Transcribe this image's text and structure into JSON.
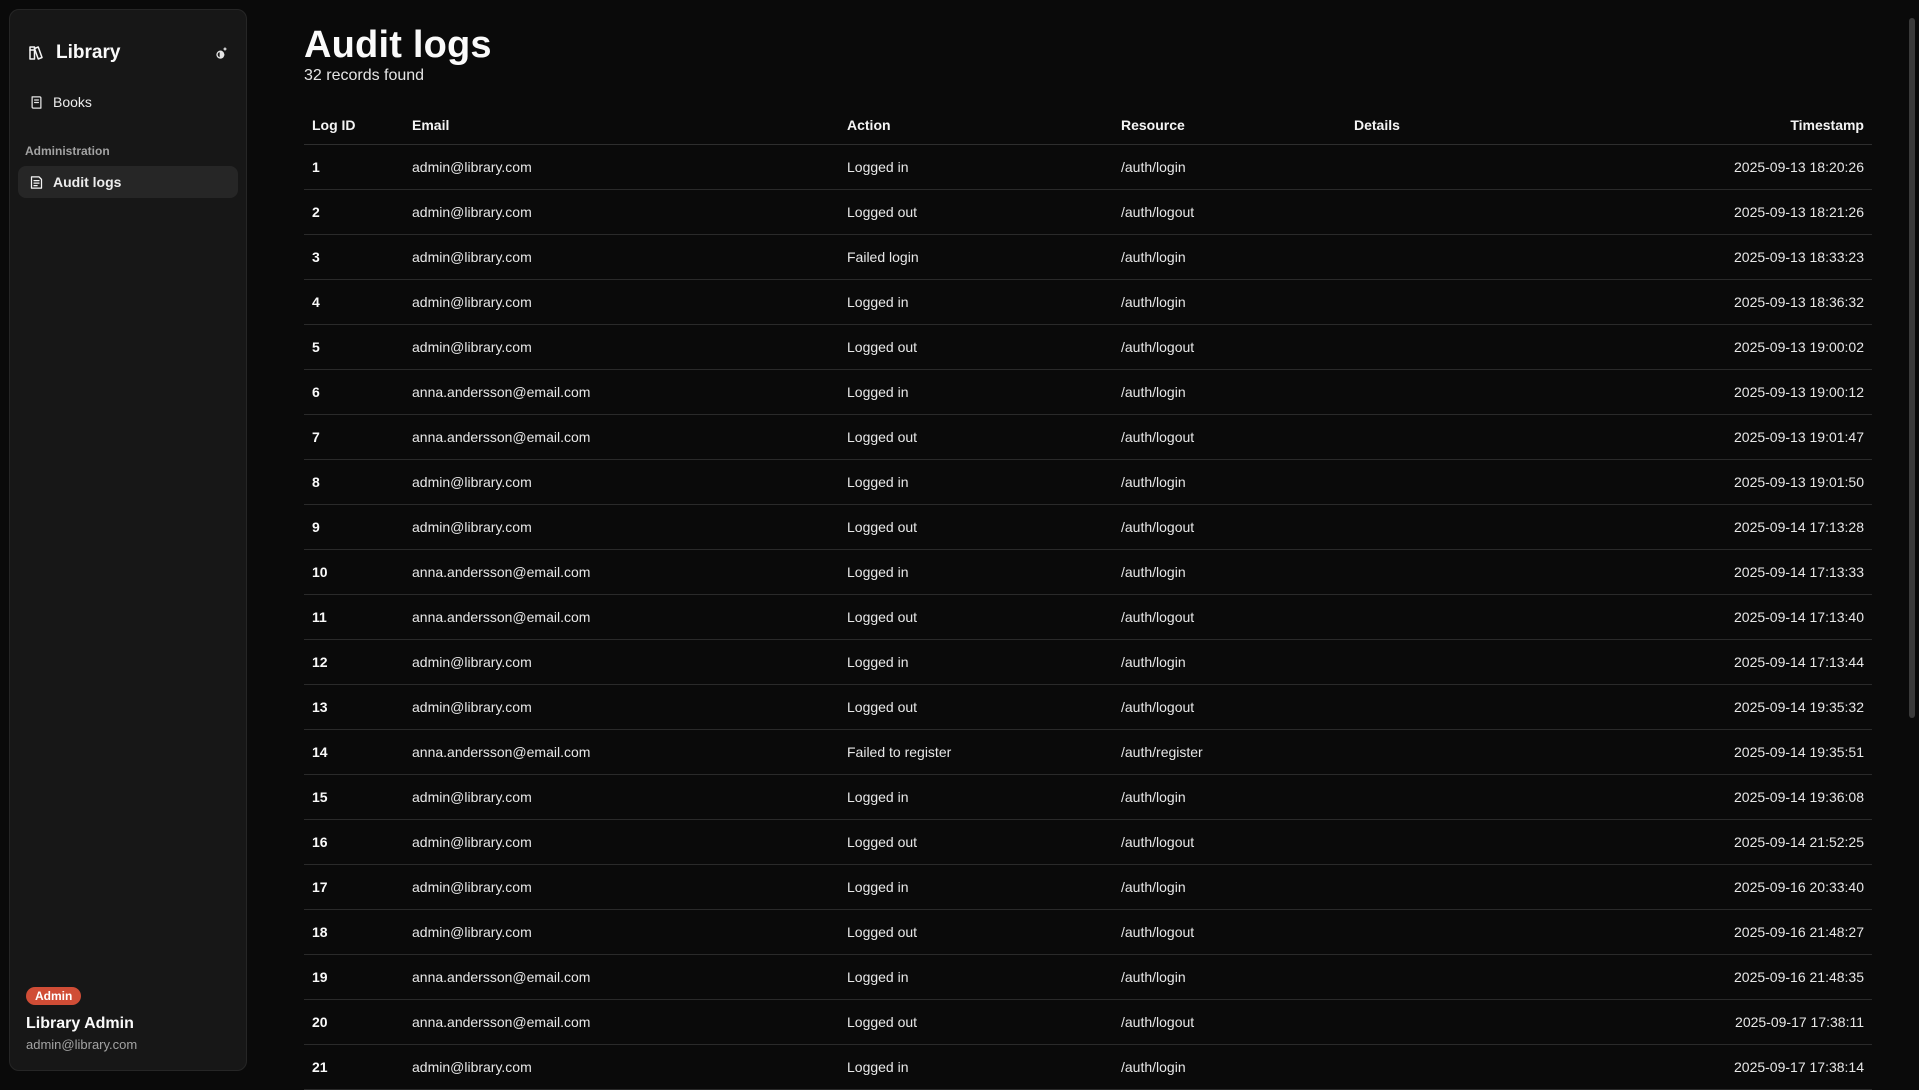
{
  "sidebar": {
    "brand": "Library",
    "nav_books": "Books",
    "section_admin": "Administration",
    "nav_audit": "Audit logs",
    "user": {
      "role": "Admin",
      "name": "Library Admin",
      "email": "admin@library.com"
    }
  },
  "page": {
    "title": "Audit logs",
    "subtitle": "32 records found"
  },
  "table": {
    "headers": {
      "id": "Log ID",
      "email": "Email",
      "action": "Action",
      "resource": "Resource",
      "details": "Details",
      "timestamp": "Timestamp"
    },
    "rows": [
      {
        "id": "1",
        "email": "admin@library.com",
        "action": "Logged in",
        "resource": "/auth/login",
        "details": "",
        "ts": "2025-09-13 18:20:26"
      },
      {
        "id": "2",
        "email": "admin@library.com",
        "action": "Logged out",
        "resource": "/auth/logout",
        "details": "",
        "ts": "2025-09-13 18:21:26"
      },
      {
        "id": "3",
        "email": "admin@library.com",
        "action": "Failed login",
        "resource": "/auth/login",
        "details": "",
        "ts": "2025-09-13 18:33:23"
      },
      {
        "id": "4",
        "email": "admin@library.com",
        "action": "Logged in",
        "resource": "/auth/login",
        "details": "",
        "ts": "2025-09-13 18:36:32"
      },
      {
        "id": "5",
        "email": "admin@library.com",
        "action": "Logged out",
        "resource": "/auth/logout",
        "details": "",
        "ts": "2025-09-13 19:00:02"
      },
      {
        "id": "6",
        "email": "anna.andersson@email.com",
        "action": "Logged in",
        "resource": "/auth/login",
        "details": "",
        "ts": "2025-09-13 19:00:12"
      },
      {
        "id": "7",
        "email": "anna.andersson@email.com",
        "action": "Logged out",
        "resource": "/auth/logout",
        "details": "",
        "ts": "2025-09-13 19:01:47"
      },
      {
        "id": "8",
        "email": "admin@library.com",
        "action": "Logged in",
        "resource": "/auth/login",
        "details": "",
        "ts": "2025-09-13 19:01:50"
      },
      {
        "id": "9",
        "email": "admin@library.com",
        "action": "Logged out",
        "resource": "/auth/logout",
        "details": "",
        "ts": "2025-09-14 17:13:28"
      },
      {
        "id": "10",
        "email": "anna.andersson@email.com",
        "action": "Logged in",
        "resource": "/auth/login",
        "details": "",
        "ts": "2025-09-14 17:13:33"
      },
      {
        "id": "11",
        "email": "anna.andersson@email.com",
        "action": "Logged out",
        "resource": "/auth/logout",
        "details": "",
        "ts": "2025-09-14 17:13:40"
      },
      {
        "id": "12",
        "email": "admin@library.com",
        "action": "Logged in",
        "resource": "/auth/login",
        "details": "",
        "ts": "2025-09-14 17:13:44"
      },
      {
        "id": "13",
        "email": "admin@library.com",
        "action": "Logged out",
        "resource": "/auth/logout",
        "details": "",
        "ts": "2025-09-14 19:35:32"
      },
      {
        "id": "14",
        "email": "anna.andersson@email.com",
        "action": "Failed to register",
        "resource": "/auth/register",
        "details": "",
        "ts": "2025-09-14 19:35:51"
      },
      {
        "id": "15",
        "email": "admin@library.com",
        "action": "Logged in",
        "resource": "/auth/login",
        "details": "",
        "ts": "2025-09-14 19:36:08"
      },
      {
        "id": "16",
        "email": "admin@library.com",
        "action": "Logged out",
        "resource": "/auth/logout",
        "details": "",
        "ts": "2025-09-14 21:52:25"
      },
      {
        "id": "17",
        "email": "admin@library.com",
        "action": "Logged in",
        "resource": "/auth/login",
        "details": "",
        "ts": "2025-09-16 20:33:40"
      },
      {
        "id": "18",
        "email": "admin@library.com",
        "action": "Logged out",
        "resource": "/auth/logout",
        "details": "",
        "ts": "2025-09-16 21:48:27"
      },
      {
        "id": "19",
        "email": "anna.andersson@email.com",
        "action": "Logged in",
        "resource": "/auth/login",
        "details": "",
        "ts": "2025-09-16 21:48:35"
      },
      {
        "id": "20",
        "email": "anna.andersson@email.com",
        "action": "Logged out",
        "resource": "/auth/logout",
        "details": "",
        "ts": "2025-09-17 17:38:11"
      },
      {
        "id": "21",
        "email": "admin@library.com",
        "action": "Logged in",
        "resource": "/auth/login",
        "details": "",
        "ts": "2025-09-17 17:38:14"
      }
    ]
  }
}
